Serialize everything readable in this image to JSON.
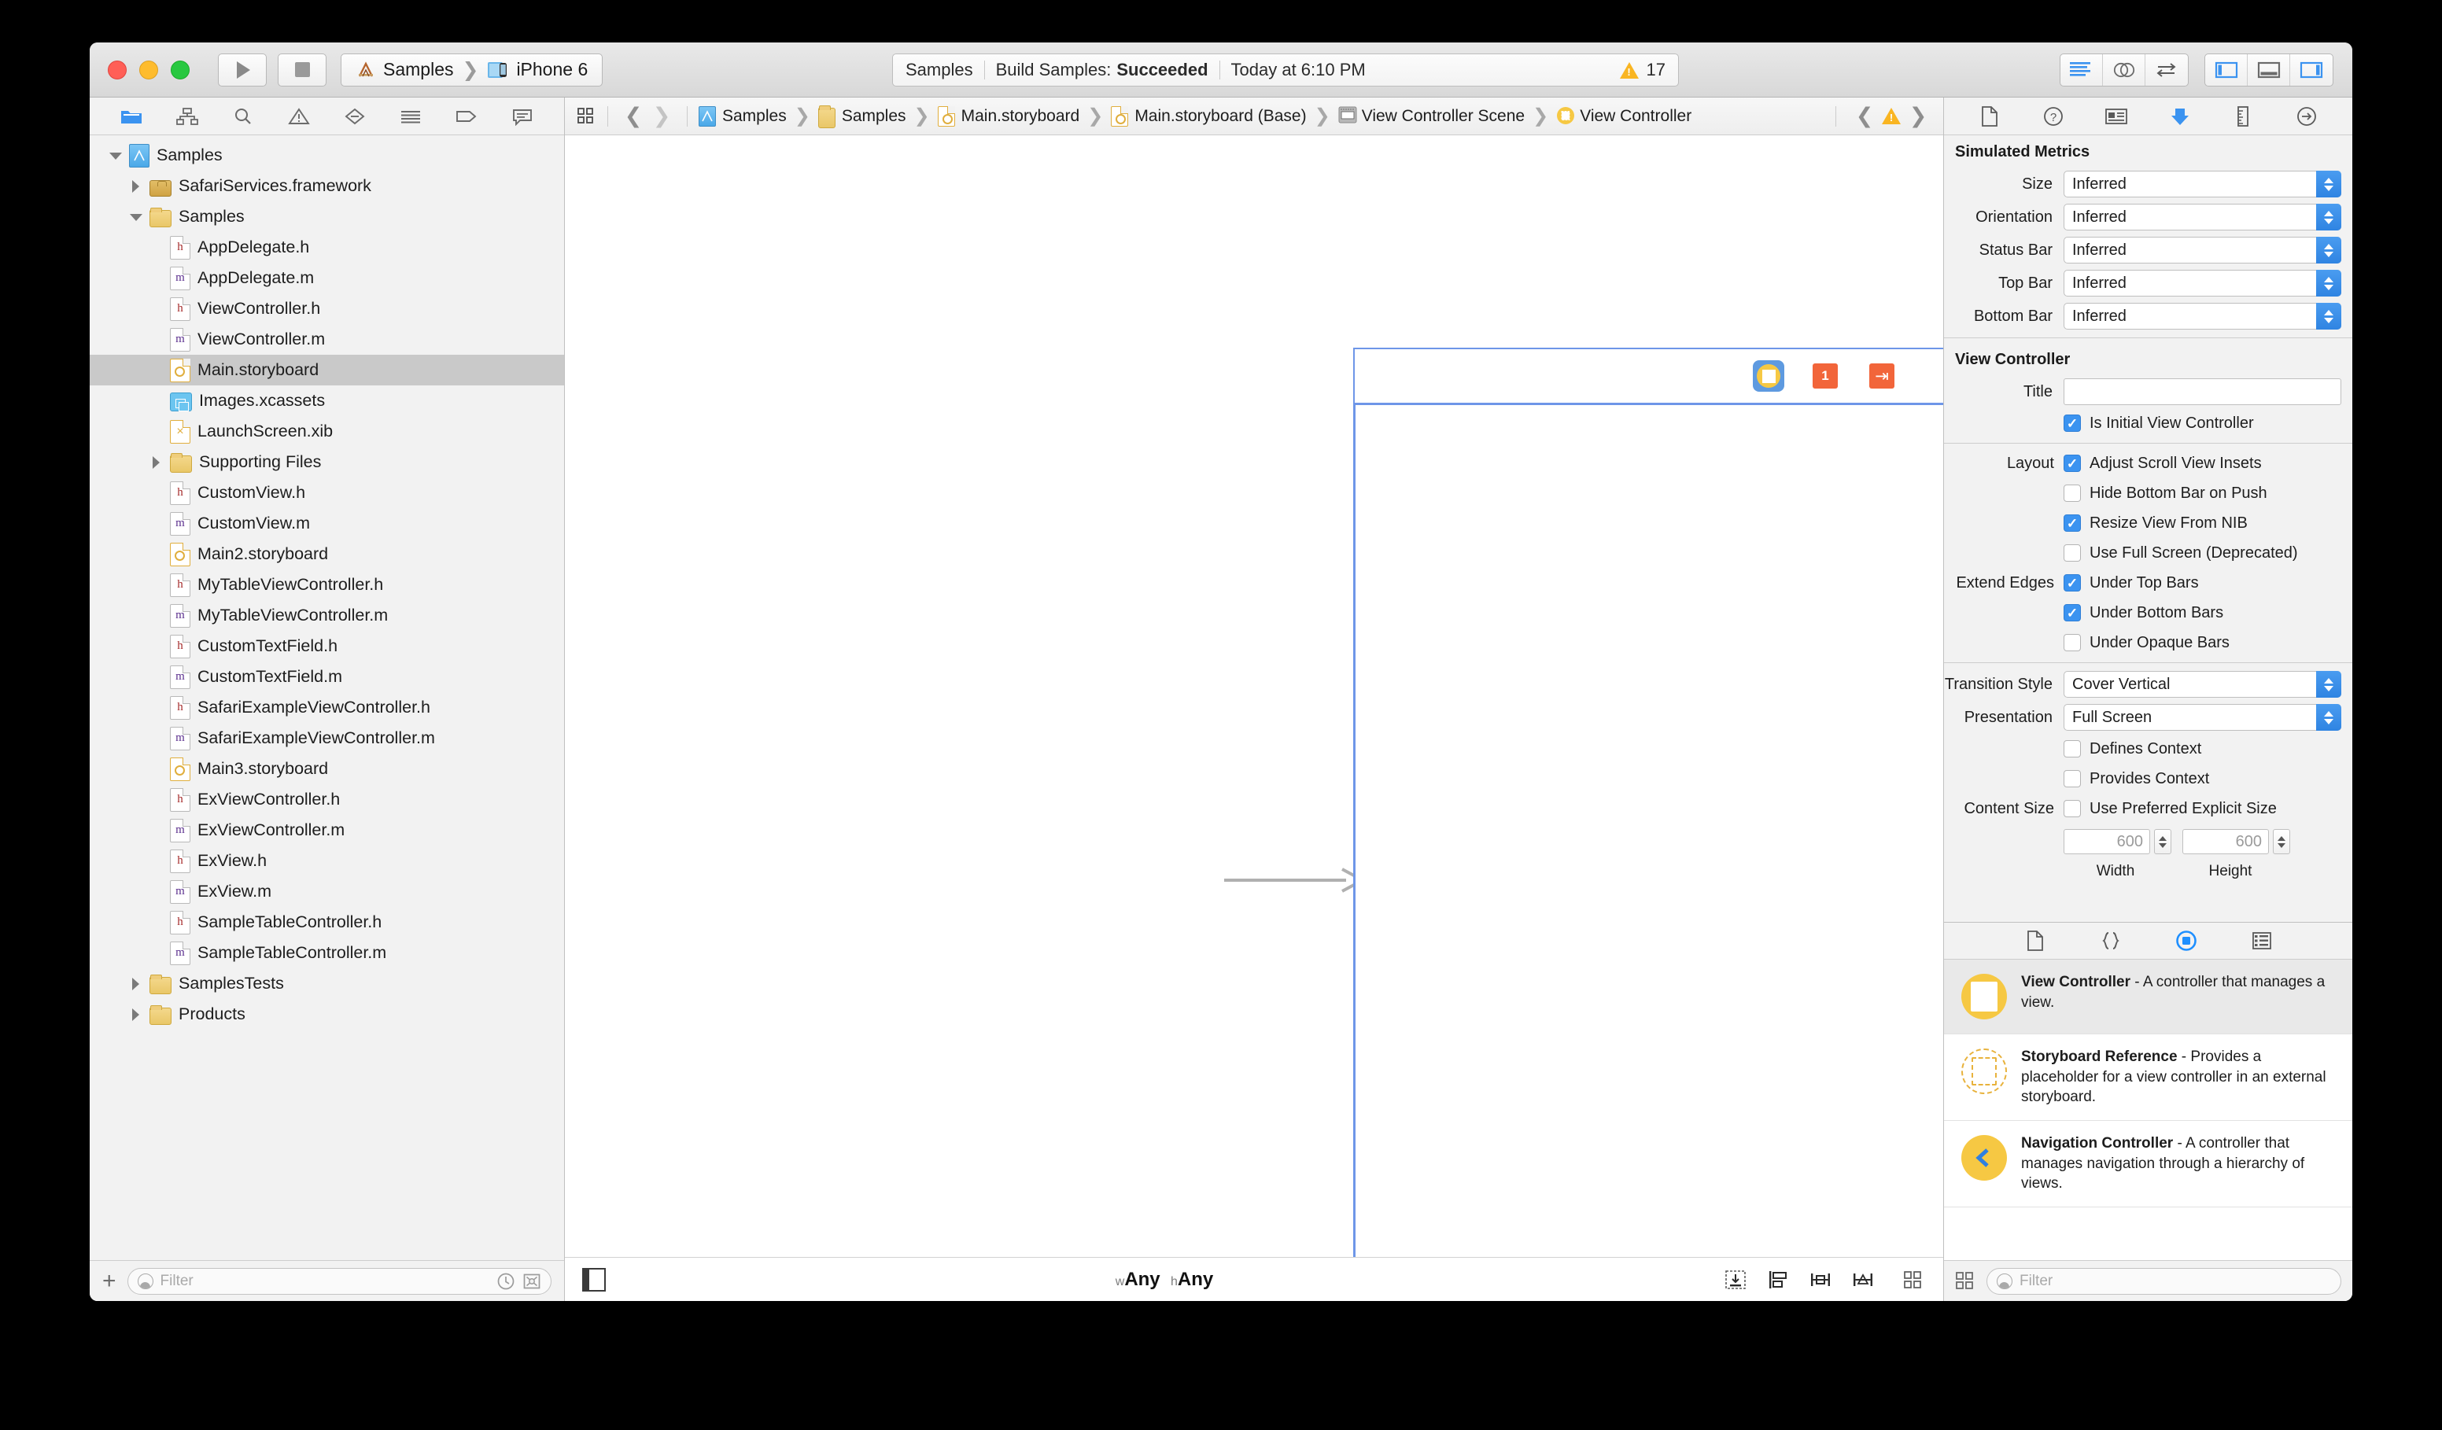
{
  "window": {
    "toolbar": {
      "run_label": "Run",
      "stop_label": "Stop",
      "scheme_project": "Samples",
      "scheme_device": "iPhone 6",
      "status": {
        "project": "Samples",
        "action": "Build Samples:",
        "result": "Succeeded",
        "time": "Today at 6:10 PM",
        "warning_count": "17"
      },
      "editor_modes": [
        "standard-editor",
        "assistant-editor",
        "version-editor"
      ],
      "view_toggles": [
        "navigator-toggle",
        "debug-area-toggle",
        "utilities-toggle"
      ]
    }
  },
  "navigator": {
    "tabs": [
      "project-navigator",
      "symbol-navigator",
      "find-navigator",
      "issue-navigator",
      "test-navigator",
      "debug-navigator",
      "breakpoint-navigator",
      "report-navigator"
    ],
    "selected_tab": "project-navigator",
    "items": [
      {
        "label": "Samples",
        "icon": "xcode-project",
        "indent": 0,
        "disclosure": "down",
        "selected": false
      },
      {
        "label": "SafariServices.framework",
        "icon": "framework",
        "indent": 1,
        "disclosure": "right",
        "selected": false
      },
      {
        "label": "Samples",
        "icon": "folder",
        "indent": 1,
        "disclosure": "down",
        "selected": false
      },
      {
        "label": "AppDelegate.h",
        "icon": "header",
        "indent": 2,
        "disclosure": "none",
        "selected": false
      },
      {
        "label": "AppDelegate.m",
        "icon": "source",
        "indent": 2,
        "disclosure": "none",
        "selected": false
      },
      {
        "label": "ViewController.h",
        "icon": "header",
        "indent": 2,
        "disclosure": "none",
        "selected": false
      },
      {
        "label": "ViewController.m",
        "icon": "source",
        "indent": 2,
        "disclosure": "none",
        "selected": false
      },
      {
        "label": "Main.storyboard",
        "icon": "storyboard",
        "indent": 2,
        "disclosure": "none",
        "selected": true
      },
      {
        "label": "Images.xcassets",
        "icon": "xcassets",
        "indent": 2,
        "disclosure": "none",
        "selected": false
      },
      {
        "label": "LaunchScreen.xib",
        "icon": "xib",
        "indent": 2,
        "disclosure": "none",
        "selected": false
      },
      {
        "label": "Supporting Files",
        "icon": "folder",
        "indent": 2,
        "disclosure": "right",
        "selected": false
      },
      {
        "label": "CustomView.h",
        "icon": "header",
        "indent": 2,
        "disclosure": "none",
        "selected": false
      },
      {
        "label": "CustomView.m",
        "icon": "source",
        "indent": 2,
        "disclosure": "none",
        "selected": false
      },
      {
        "label": "Main2.storyboard",
        "icon": "storyboard",
        "indent": 2,
        "disclosure": "none",
        "selected": false
      },
      {
        "label": "MyTableViewController.h",
        "icon": "header",
        "indent": 2,
        "disclosure": "none",
        "selected": false
      },
      {
        "label": "MyTableViewController.m",
        "icon": "source",
        "indent": 2,
        "disclosure": "none",
        "selected": false
      },
      {
        "label": "CustomTextField.h",
        "icon": "header",
        "indent": 2,
        "disclosure": "none",
        "selected": false
      },
      {
        "label": "CustomTextField.m",
        "icon": "source",
        "indent": 2,
        "disclosure": "none",
        "selected": false
      },
      {
        "label": "SafariExampleViewController.h",
        "icon": "header",
        "indent": 2,
        "disclosure": "none",
        "selected": false
      },
      {
        "label": "SafariExampleViewController.m",
        "icon": "source",
        "indent": 2,
        "disclosure": "none",
        "selected": false
      },
      {
        "label": "Main3.storyboard",
        "icon": "storyboard",
        "indent": 2,
        "disclosure": "none",
        "selected": false
      },
      {
        "label": "ExViewController.h",
        "icon": "header",
        "indent": 2,
        "disclosure": "none",
        "selected": false
      },
      {
        "label": "ExViewController.m",
        "icon": "source",
        "indent": 2,
        "disclosure": "none",
        "selected": false
      },
      {
        "label": "ExView.h",
        "icon": "header",
        "indent": 2,
        "disclosure": "none",
        "selected": false
      },
      {
        "label": "ExView.m",
        "icon": "source",
        "indent": 2,
        "disclosure": "none",
        "selected": false
      },
      {
        "label": "SampleTableController.h",
        "icon": "header",
        "indent": 2,
        "disclosure": "none",
        "selected": false
      },
      {
        "label": "SampleTableController.m",
        "icon": "source",
        "indent": 2,
        "disclosure": "none",
        "selected": false
      },
      {
        "label": "SamplesTests",
        "icon": "folder",
        "indent": 1,
        "disclosure": "right",
        "selected": false
      },
      {
        "label": "Products",
        "icon": "folder",
        "indent": 1,
        "disclosure": "right",
        "selected": false
      }
    ],
    "filter_placeholder": "Filter",
    "add_label": "+"
  },
  "editor": {
    "jumpbar": {
      "crumbs": [
        {
          "label": "Samples",
          "icon": "xcode-project"
        },
        {
          "label": "Samples",
          "icon": "folder"
        },
        {
          "label": "Main.storyboard",
          "icon": "storyboard"
        },
        {
          "label": "Main.storyboard (Base)",
          "icon": "storyboard"
        },
        {
          "label": "View Controller Scene",
          "icon": "scene"
        },
        {
          "label": "View Controller",
          "icon": "view-controller"
        }
      ]
    },
    "scene": {
      "dock_items": [
        "view-controller",
        "first-responder",
        "exit"
      ],
      "first_responder_badge": "1"
    },
    "bottom": {
      "size_class_w_prefix": "w",
      "size_class_w": "Any",
      "size_class_h_prefix": "h",
      "size_class_h": "Any",
      "layout_buttons": [
        "update-frames",
        "align",
        "pin",
        "resolve-auto-layout-issues",
        "document-outline"
      ]
    }
  },
  "utilities": {
    "inspector_tabs": [
      "file-inspector",
      "quick-help-inspector",
      "identity-inspector",
      "attributes-inspector",
      "size-inspector",
      "connections-inspector"
    ],
    "selected_inspector": "attributes-inspector",
    "simulated_metrics": {
      "title": "Simulated Metrics",
      "fields": [
        {
          "label": "Size",
          "value": "Inferred"
        },
        {
          "label": "Orientation",
          "value": "Inferred"
        },
        {
          "label": "Status Bar",
          "value": "Inferred"
        },
        {
          "label": "Top Bar",
          "value": "Inferred"
        },
        {
          "label": "Bottom Bar",
          "value": "Inferred"
        }
      ]
    },
    "view_controller": {
      "title": "View Controller",
      "title_label": "Title",
      "title_value": "",
      "is_initial": {
        "label": "Is Initial View Controller",
        "checked": true
      },
      "layout_label": "Layout",
      "layout_options": [
        {
          "label": "Adjust Scroll View Insets",
          "checked": true
        },
        {
          "label": "Hide Bottom Bar on Push",
          "checked": false
        },
        {
          "label": "Resize View From NIB",
          "checked": true
        },
        {
          "label": "Use Full Screen (Deprecated)",
          "checked": false
        }
      ],
      "extend_edges_label": "Extend Edges",
      "extend_edges_options": [
        {
          "label": "Under Top Bars",
          "checked": true
        },
        {
          "label": "Under Bottom Bars",
          "checked": true
        },
        {
          "label": "Under Opaque Bars",
          "checked": false
        }
      ],
      "transition_style": {
        "label": "Transition Style",
        "value": "Cover Vertical"
      },
      "presentation": {
        "label": "Presentation",
        "value": "Full Screen"
      },
      "context_options": [
        {
          "label": "Defines Context",
          "checked": false
        },
        {
          "label": "Provides Context",
          "checked": false
        }
      ],
      "content_size_label": "Content Size",
      "content_size_option": {
        "label": "Use Preferred Explicit Size",
        "checked": false
      },
      "width_value": "600",
      "height_value": "600",
      "width_label": "Width",
      "height_label": "Height"
    },
    "library": {
      "tabs": [
        "file-template-library",
        "code-snippet-library",
        "object-library",
        "media-library"
      ],
      "selected_tab": "object-library",
      "items": [
        {
          "name": "View Controller",
          "desc": " - A controller that manages a view.",
          "icon": "view-controller",
          "selected": true
        },
        {
          "name": "Storyboard Reference",
          "desc": " - Provides a placeholder for a view controller in an external storyboard.",
          "icon": "storyboard-reference",
          "selected": false
        },
        {
          "name": "Navigation Controller",
          "desc": " - A controller that manages navigation through a hierarchy of views.",
          "icon": "navigation-controller",
          "selected": false
        }
      ],
      "filter_placeholder": "Filter"
    }
  },
  "colors": {
    "accent_blue": "#3b93f0",
    "scene_border": "#6e96e8",
    "warning_yellow": "#f9b522",
    "object_yellow": "#f6c843",
    "orange": "#f2653a"
  }
}
